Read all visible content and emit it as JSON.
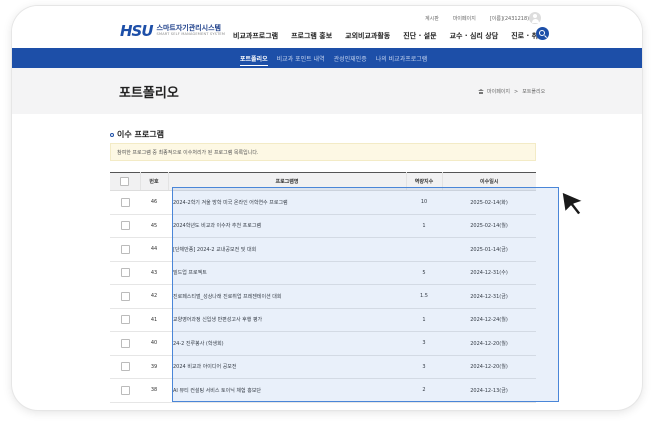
{
  "header": {
    "logo_mark": "HSU",
    "logo_title": "스마트자기관리시스템",
    "logo_subtitle": "SMART SELF MANAGEMENT SYSTEM",
    "util_links": [
      "계시판",
      "마이페이지"
    ],
    "user_label": "[이름](2431218)",
    "gnb": [
      "비교과프로그램",
      "프로그램 홍보",
      "교외비교과활동",
      "진단 · 설문",
      "교수 · 심리 상담",
      "진로 · 취업"
    ]
  },
  "subnav": {
    "items": [
      "포트폴리오",
      "비교과 포인트 내역",
      "관성인재인증",
      "나의 비교과프로그램"
    ],
    "active_index": 0
  },
  "page": {
    "title": "포트폴리오",
    "breadcrumb": [
      "마이페이지",
      "포트폴리오"
    ],
    "breadcrumb_sep": ">"
  },
  "section": {
    "title": "이수 프로그램",
    "notice": "참여한 프로그램 중 최종적으로 이수처리가 된 프로그램 목록입니다."
  },
  "table": {
    "headers": [
      "번호",
      "프로그램명",
      "역량지수",
      "이수일시"
    ],
    "rows": [
      {
        "no": "46",
        "name": "2024-2학기 겨울 방학 미국 온라인 어학연수 프로그램",
        "score": "10",
        "date": "2025-02-14(화)"
      },
      {
        "no": "45",
        "name": "2024학년도 비교과 이수자 추천 프로그램",
        "score": "1",
        "date": "2025-02-14(월)"
      },
      {
        "no": "44",
        "name": "[단체만종] 2024-2 교내공모전 및 대회",
        "score": "",
        "date": "2025-01-14(금)"
      },
      {
        "no": "43",
        "name": "빌드업 프로젝트",
        "score": "5",
        "date": "2024-12-31(수)"
      },
      {
        "no": "42",
        "name": "진로페스티벌_성상나래 진로취업 프레젠테이션 대회",
        "score": "1.5",
        "date": "2024-12-31(금)"
      },
      {
        "no": "41",
        "name": "교양영어과정 신입생 반편성고사 후행 평가",
        "score": "1",
        "date": "2024-12-24(월)"
      },
      {
        "no": "40",
        "name": "24-2 진루봉사 (학생회)",
        "score": "3",
        "date": "2024-12-20(월)"
      },
      {
        "no": "39",
        "name": "2024 비교과 아이디어 공모전",
        "score": "3",
        "date": "2024-12-20(월)"
      },
      {
        "no": "38",
        "name": "AI 뷰티 컨설팅 서비스 토이닉 체험 홍보단",
        "score": "2",
        "date": "2024-12-13(금)"
      }
    ]
  },
  "colors": {
    "brand": "#1d4fa8",
    "highlight": "#4a86d8",
    "notice_bg": "#fdf8e4"
  }
}
